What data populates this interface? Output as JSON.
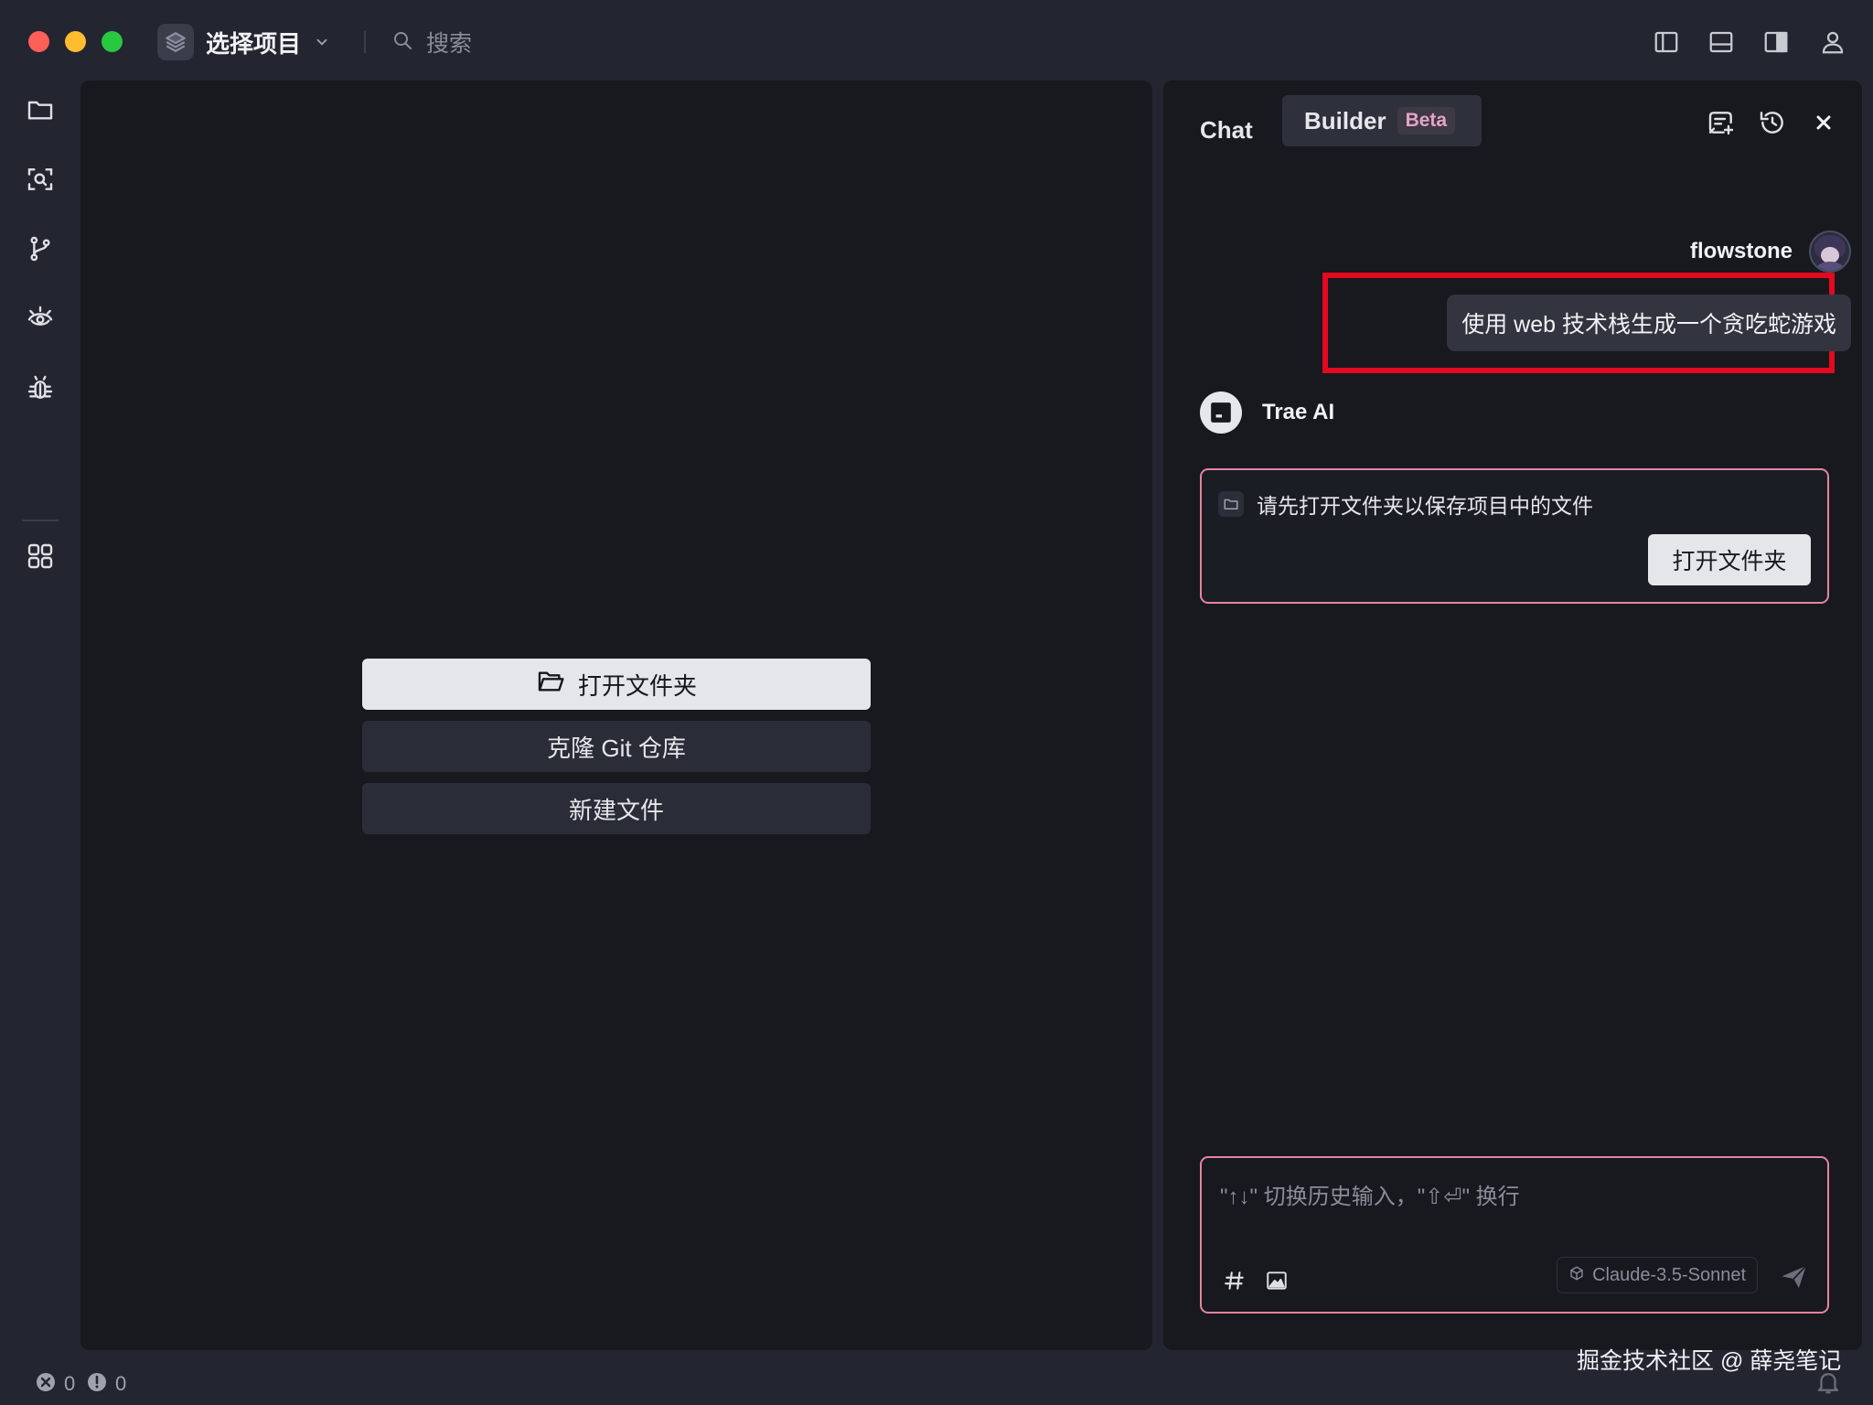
{
  "titlebar": {
    "project_label": "选择项目",
    "search_placeholder": "搜索"
  },
  "activity_bar": {
    "items": [
      "folder-icon",
      "search-icon",
      "source-control-icon",
      "eye-icon",
      "bug-icon",
      "apps-icon"
    ]
  },
  "welcome": {
    "open_folder": "打开文件夹",
    "clone_git": "克隆 Git 仓库",
    "new_file": "新建文件"
  },
  "panel": {
    "tabs": [
      {
        "label": "Chat"
      },
      {
        "label": "Builder",
        "badge": "Beta",
        "active": true
      }
    ],
    "user": {
      "name": "flowstone",
      "message": "使用 web 技术栈生成一个贪吃蛇游戏"
    },
    "ai": {
      "name": "Trae AI",
      "notice_text": "请先打开文件夹以保存项目中的文件",
      "notice_button": "打开文件夹"
    },
    "input": {
      "placeholder": "\"↑↓\" 切换历史输入，\"⇧⏎\" 换行",
      "model": "Claude-3.5-Sonnet"
    }
  },
  "status_bar": {
    "errors": "0",
    "warnings": "0",
    "watermark": "掘金技术社区 @ 薛尧笔记"
  },
  "colors": {
    "highlight": "#e3091e",
    "accent_border": "#e6849e",
    "beta_text": "#e7a2c8"
  }
}
